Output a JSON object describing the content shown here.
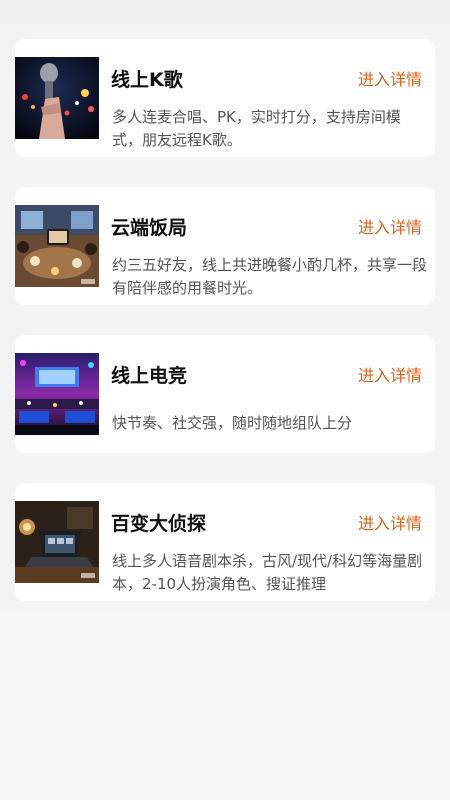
{
  "accent_color": "#e0621a",
  "cards": [
    {
      "title": "线上K歌",
      "link_label": "进入详情",
      "description": "多人连麦合唱、PK，实时打分，支持房间模式，朋友远程K歌。",
      "image": "microphone-stage-image"
    },
    {
      "title": "云端饭局",
      "link_label": "进入详情",
      "description": "约三五好友，线上共进晚餐小酌几杯，共享一段有陪伴感的用餐时光。",
      "image": "online-dinner-image"
    },
    {
      "title": "线上电竞",
      "link_label": "进入详情",
      "description": "快节奏、社交强，随时随地组队上分",
      "image": "esports-arena-image"
    },
    {
      "title": "百变大侦探",
      "link_label": "进入详情",
      "description": "线上多人语音剧本杀，古风/现代/科幻等海量剧本，2-10人扮演角色、搜证推理",
      "image": "detective-laptop-image"
    }
  ]
}
